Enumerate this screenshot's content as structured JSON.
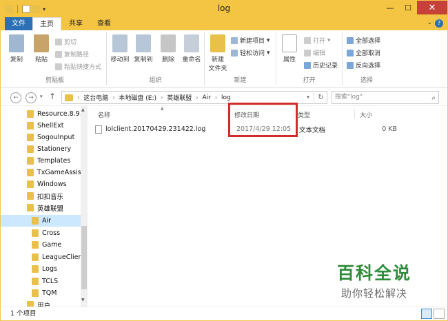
{
  "window": {
    "title": "log"
  },
  "tabs": {
    "file": "文件",
    "home": "主页",
    "share": "共享",
    "view": "查看"
  },
  "ribbon": {
    "clipboard": {
      "group": "剪贴板",
      "copy": "复制",
      "paste": "粘贴",
      "cut": "剪切",
      "copy_path": "复制路径",
      "paste_shortcut": "粘贴快捷方式"
    },
    "organize": {
      "group": "组织",
      "move_to": "移动到",
      "copy_to": "复制到",
      "delete": "删除",
      "rename": "重命名"
    },
    "new": {
      "group": "新建",
      "new_folder_line1": "新建",
      "new_folder_line2": "文件夹",
      "new_item": "新建项目",
      "easy_access": "轻松访问"
    },
    "open": {
      "group": "打开",
      "properties": "属性",
      "open": "打开",
      "edit": "编辑",
      "history": "历史记录"
    },
    "select": {
      "group": "选择",
      "select_all": "全部选择",
      "select_none": "全部取消",
      "invert": "反向选择"
    }
  },
  "address": {
    "crumbs": [
      "这台电脑",
      "本地磁盘 (E:)",
      "英雄联盟",
      "Air",
      "log"
    ],
    "search_placeholder": "搜索\"log\""
  },
  "nav": {
    "items": [
      "Resource.8.9.",
      "ShellExt",
      "SogouInput",
      "Stationery",
      "Templates",
      "TxGameAssist",
      "Windows",
      "扣扣音乐",
      "英雄联盟",
      "Air",
      "Cross",
      "Game",
      "LeagueClien",
      "Logs",
      "TCLS",
      "TQM",
      "用户"
    ]
  },
  "columns": {
    "name": "名称",
    "date": "修改日期",
    "type": "类型",
    "size": "大小"
  },
  "files": [
    {
      "name": "lolclient.20170429.231422.log",
      "date": "2017/4/29 12:05",
      "type": "文本文档",
      "size": "0 KB"
    }
  ],
  "status": {
    "count": "1 个项目"
  },
  "watermark": {
    "line1": "百科全说",
    "line2": "助你轻松解决"
  },
  "colors": {
    "titlebar": "#f4c542",
    "file_tab": "#2b6fb5",
    "highlight_box": "#d32b2b",
    "selected_nav": "#cce8ff"
  }
}
